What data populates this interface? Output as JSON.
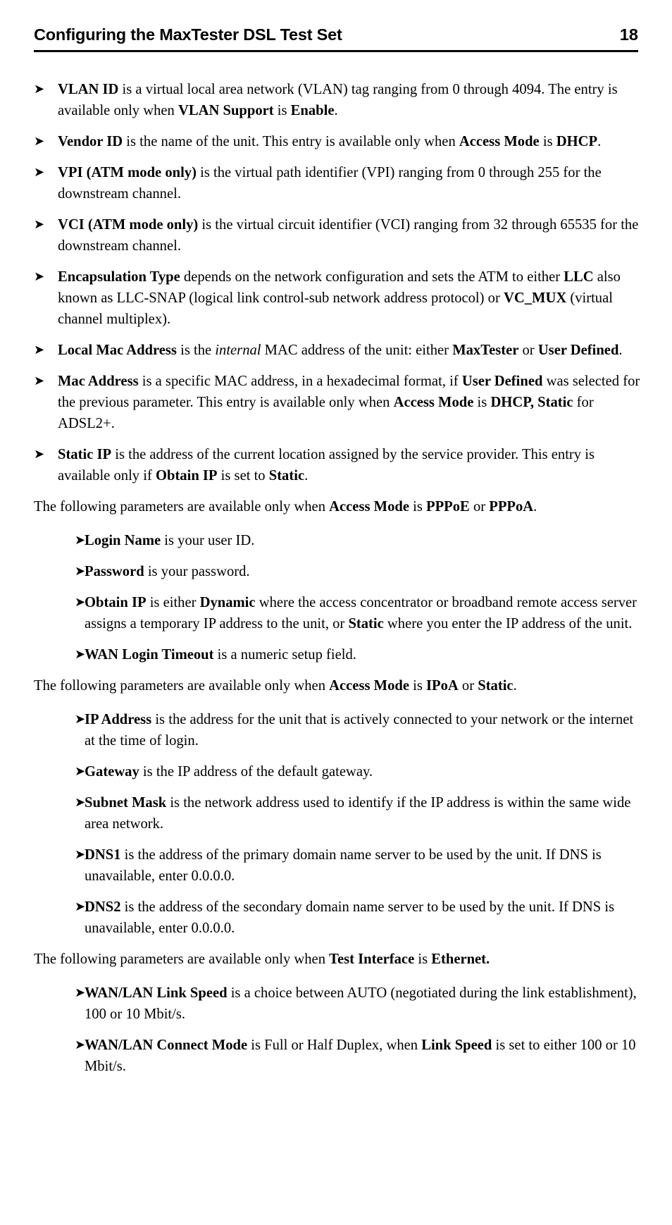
{
  "header": {
    "title": "Configuring the MaxTester DSL Test Set",
    "page_number": "18"
  },
  "bullet_glyph": "➤",
  "blocks": [
    {
      "kind": "bullet",
      "level": 1,
      "name": "bullet-vlan-id",
      "html": "<b>VLAN ID</b> is a virtual local area network (VLAN) tag ranging from 0 through 4094. The entry is available only when <b>VLAN Support</b> is <b>Enable</b>.",
      "text": "VLAN ID is a virtual local area network (VLAN) tag ranging from 0 through 4094. The entry is available only when VLAN Support is Enable."
    },
    {
      "kind": "bullet",
      "level": 1,
      "name": "bullet-vendor-id",
      "html": "<b>Vendor ID</b> is the name of the unit. This entry is available only when <b>Access Mode</b> is <b>DHCP</b>.",
      "text": "Vendor ID is the name of the unit. This entry is available only when Access Mode is DHCP."
    },
    {
      "kind": "bullet",
      "level": 1,
      "name": "bullet-vpi",
      "html": "<b>VPI (ATM mode only)</b> is the virtual path identifier (VPI) ranging from 0 through 255 for the downstream channel.",
      "text": "VPI (ATM mode only) is the virtual path identifier (VPI) ranging from 0 through 255 for the downstream channel."
    },
    {
      "kind": "bullet",
      "level": 1,
      "name": "bullet-vci",
      "html": "<b>VCI (ATM mode only)</b> is the virtual circuit identifier (VCI) ranging from 32 through 65535 for the downstream channel.",
      "text": "VCI (ATM mode only) is the virtual circuit identifier (VCI) ranging from 32 through 65535 for the downstream channel."
    },
    {
      "kind": "bullet",
      "level": 1,
      "name": "bullet-encapsulation-type",
      "html": "<b>Encapsulation Type</b> depends on the network configuration and sets the ATM to either <b>LLC</b> also known as LLC-SNAP (logical link control-sub network address protocol) or <b>VC_MUX</b> (virtual channel multiplex).",
      "text": "Encapsulation Type depends on the network configuration and sets the ATM to either LLC also known as LLC-SNAP (logical link control-sub network address protocol) or VC_MUX (virtual channel multiplex)."
    },
    {
      "kind": "bullet",
      "level": 1,
      "name": "bullet-local-mac-address",
      "html": "<b>Local Mac Address</b> is the <i>internal</i> MAC address of the unit: either <b>MaxTester</b> or <b>User Defined</b>.",
      "text": "Local Mac Address is the internal MAC address of the unit: either MaxTester or User Defined."
    },
    {
      "kind": "bullet",
      "level": 1,
      "name": "bullet-mac-address",
      "html": "<b>Mac Address</b> is a specific MAC address, in a hexadecimal format, if <b>User Defined</b> was selected for the previous parameter. This entry is available only when <b>Access Mode</b> is <b>DHCP, Static</b> for ADSL2+.",
      "text": "Mac Address is a specific MAC address, in a hexadecimal format, if User Defined was selected for the previous parameter. This entry is available only when Access Mode is DHCP, Static for ADSL2+."
    },
    {
      "kind": "bullet",
      "level": 1,
      "name": "bullet-static-ip",
      "html": "<b>Static IP</b> is the address of the current location assigned by the service provider. This entry is available only if <b>Obtain IP</b> is set to <b>Static</b>.",
      "text": "Static IP is the address of the current location assigned by the service provider. This entry is available only if Obtain IP is set to Static."
    },
    {
      "kind": "para",
      "level": 0,
      "name": "paragraph-pppoe-pppoa-intro",
      "html": "The following parameters are available only when <b>Access Mode</b> is <b>PPPoE</b> or <b>PPPoA</b>.",
      "text": "The following parameters are available only when Access Mode is PPPoE or PPPoA."
    },
    {
      "kind": "bullet",
      "level": 2,
      "name": "bullet-login-name",
      "html": "<b>Login Name</b> is your user ID.",
      "text": "Login Name is your user ID."
    },
    {
      "kind": "bullet",
      "level": 2,
      "name": "bullet-password",
      "html": "<b>Password</b> is your password.",
      "text": "Password is your password."
    },
    {
      "kind": "bullet",
      "level": 2,
      "name": "bullet-obtain-ip",
      "html": "<b>Obtain IP</b> is either <b>Dynamic</b> where the access concentrator or broadband remote access server assigns a temporary IP address to the unit, or <b>Static</b> where you enter the IP address of the unit.",
      "text": "Obtain IP is either Dynamic where the access concentrator or broadband remote access server assigns a temporary IP address to the unit, or Static where you enter the IP address of the unit."
    },
    {
      "kind": "bullet",
      "level": 2,
      "name": "bullet-wan-login-timeout",
      "html": "<b>WAN Login Timeout</b> is a numeric setup field.",
      "text": "WAN Login Timeout is a numeric setup field."
    },
    {
      "kind": "para",
      "level": 0,
      "name": "paragraph-ipoa-static-intro",
      "html": "The following parameters are available only when <b>Access Mode</b> is <b>IPoA</b> or <b>Static</b>.",
      "text": "The following parameters are available only when Access Mode is IPoA or Static."
    },
    {
      "kind": "bullet",
      "level": 2,
      "name": "bullet-ip-address",
      "html": "<b>IP Address</b> is the address for the unit that is actively connected to your network or the internet at the time of login.",
      "text": "IP Address is the address for the unit that is actively connected to your network or the internet at the time of login."
    },
    {
      "kind": "bullet",
      "level": 2,
      "name": "bullet-gateway",
      "html": "<b>Gateway</b> is the IP address of the default gateway.",
      "text": "Gateway is the IP address of the default gateway."
    },
    {
      "kind": "bullet",
      "level": 2,
      "name": "bullet-subnet-mask",
      "html": "<b>Subnet Mask</b> is the network address used to identify if the IP address is within the same wide area network.",
      "text": "Subnet Mask is the network address used to identify if the IP address is within the same wide area network."
    },
    {
      "kind": "bullet",
      "level": 2,
      "name": "bullet-dns1",
      "html": "<b>DNS1</b> is the address of the primary domain name server to be used by the unit. If DNS is unavailable, enter 0.0.0.0.",
      "text": "DNS1 is the address of the primary domain name server to be used by the unit. If DNS is unavailable, enter 0.0.0.0."
    },
    {
      "kind": "bullet",
      "level": 2,
      "name": "bullet-dns2",
      "html": "<b>DNS2</b> is the address of the secondary domain name server to be used by the unit. If DNS is unavailable, enter 0.0.0.0.",
      "text": "DNS2 is the address of the secondary domain name server to be used by the unit. If DNS is unavailable, enter 0.0.0.0."
    },
    {
      "kind": "para",
      "level": 0,
      "name": "paragraph-ethernet-intro",
      "html": "The following parameters are available only when <b>Test Interface</b> is <b>Ethernet.</b>",
      "text": "The following parameters are available only when Test Interface is Ethernet."
    },
    {
      "kind": "bullet",
      "level": 2,
      "name": "bullet-wan-lan-link-speed",
      "html": "<b>WAN/LAN Link Speed</b> is a choice between AUTO (negotiated during the link establishment), 100 or 10 Mbit/s.",
      "text": "WAN/LAN Link Speed is a choice between AUTO (negotiated during the link establishment), 100 or 10 Mbit/s."
    },
    {
      "kind": "bullet",
      "level": 2,
      "name": "bullet-wan-lan-connect-mode",
      "html": "<b>WAN/LAN Connect Mode</b> is Full or Half Duplex, when <b>Link Speed</b> is set to either 100 or 10 Mbit/s.",
      "text": "WAN/LAN Connect Mode is Full or Half Duplex, when Link Speed is set to either 100 or 10 Mbit/s."
    }
  ]
}
